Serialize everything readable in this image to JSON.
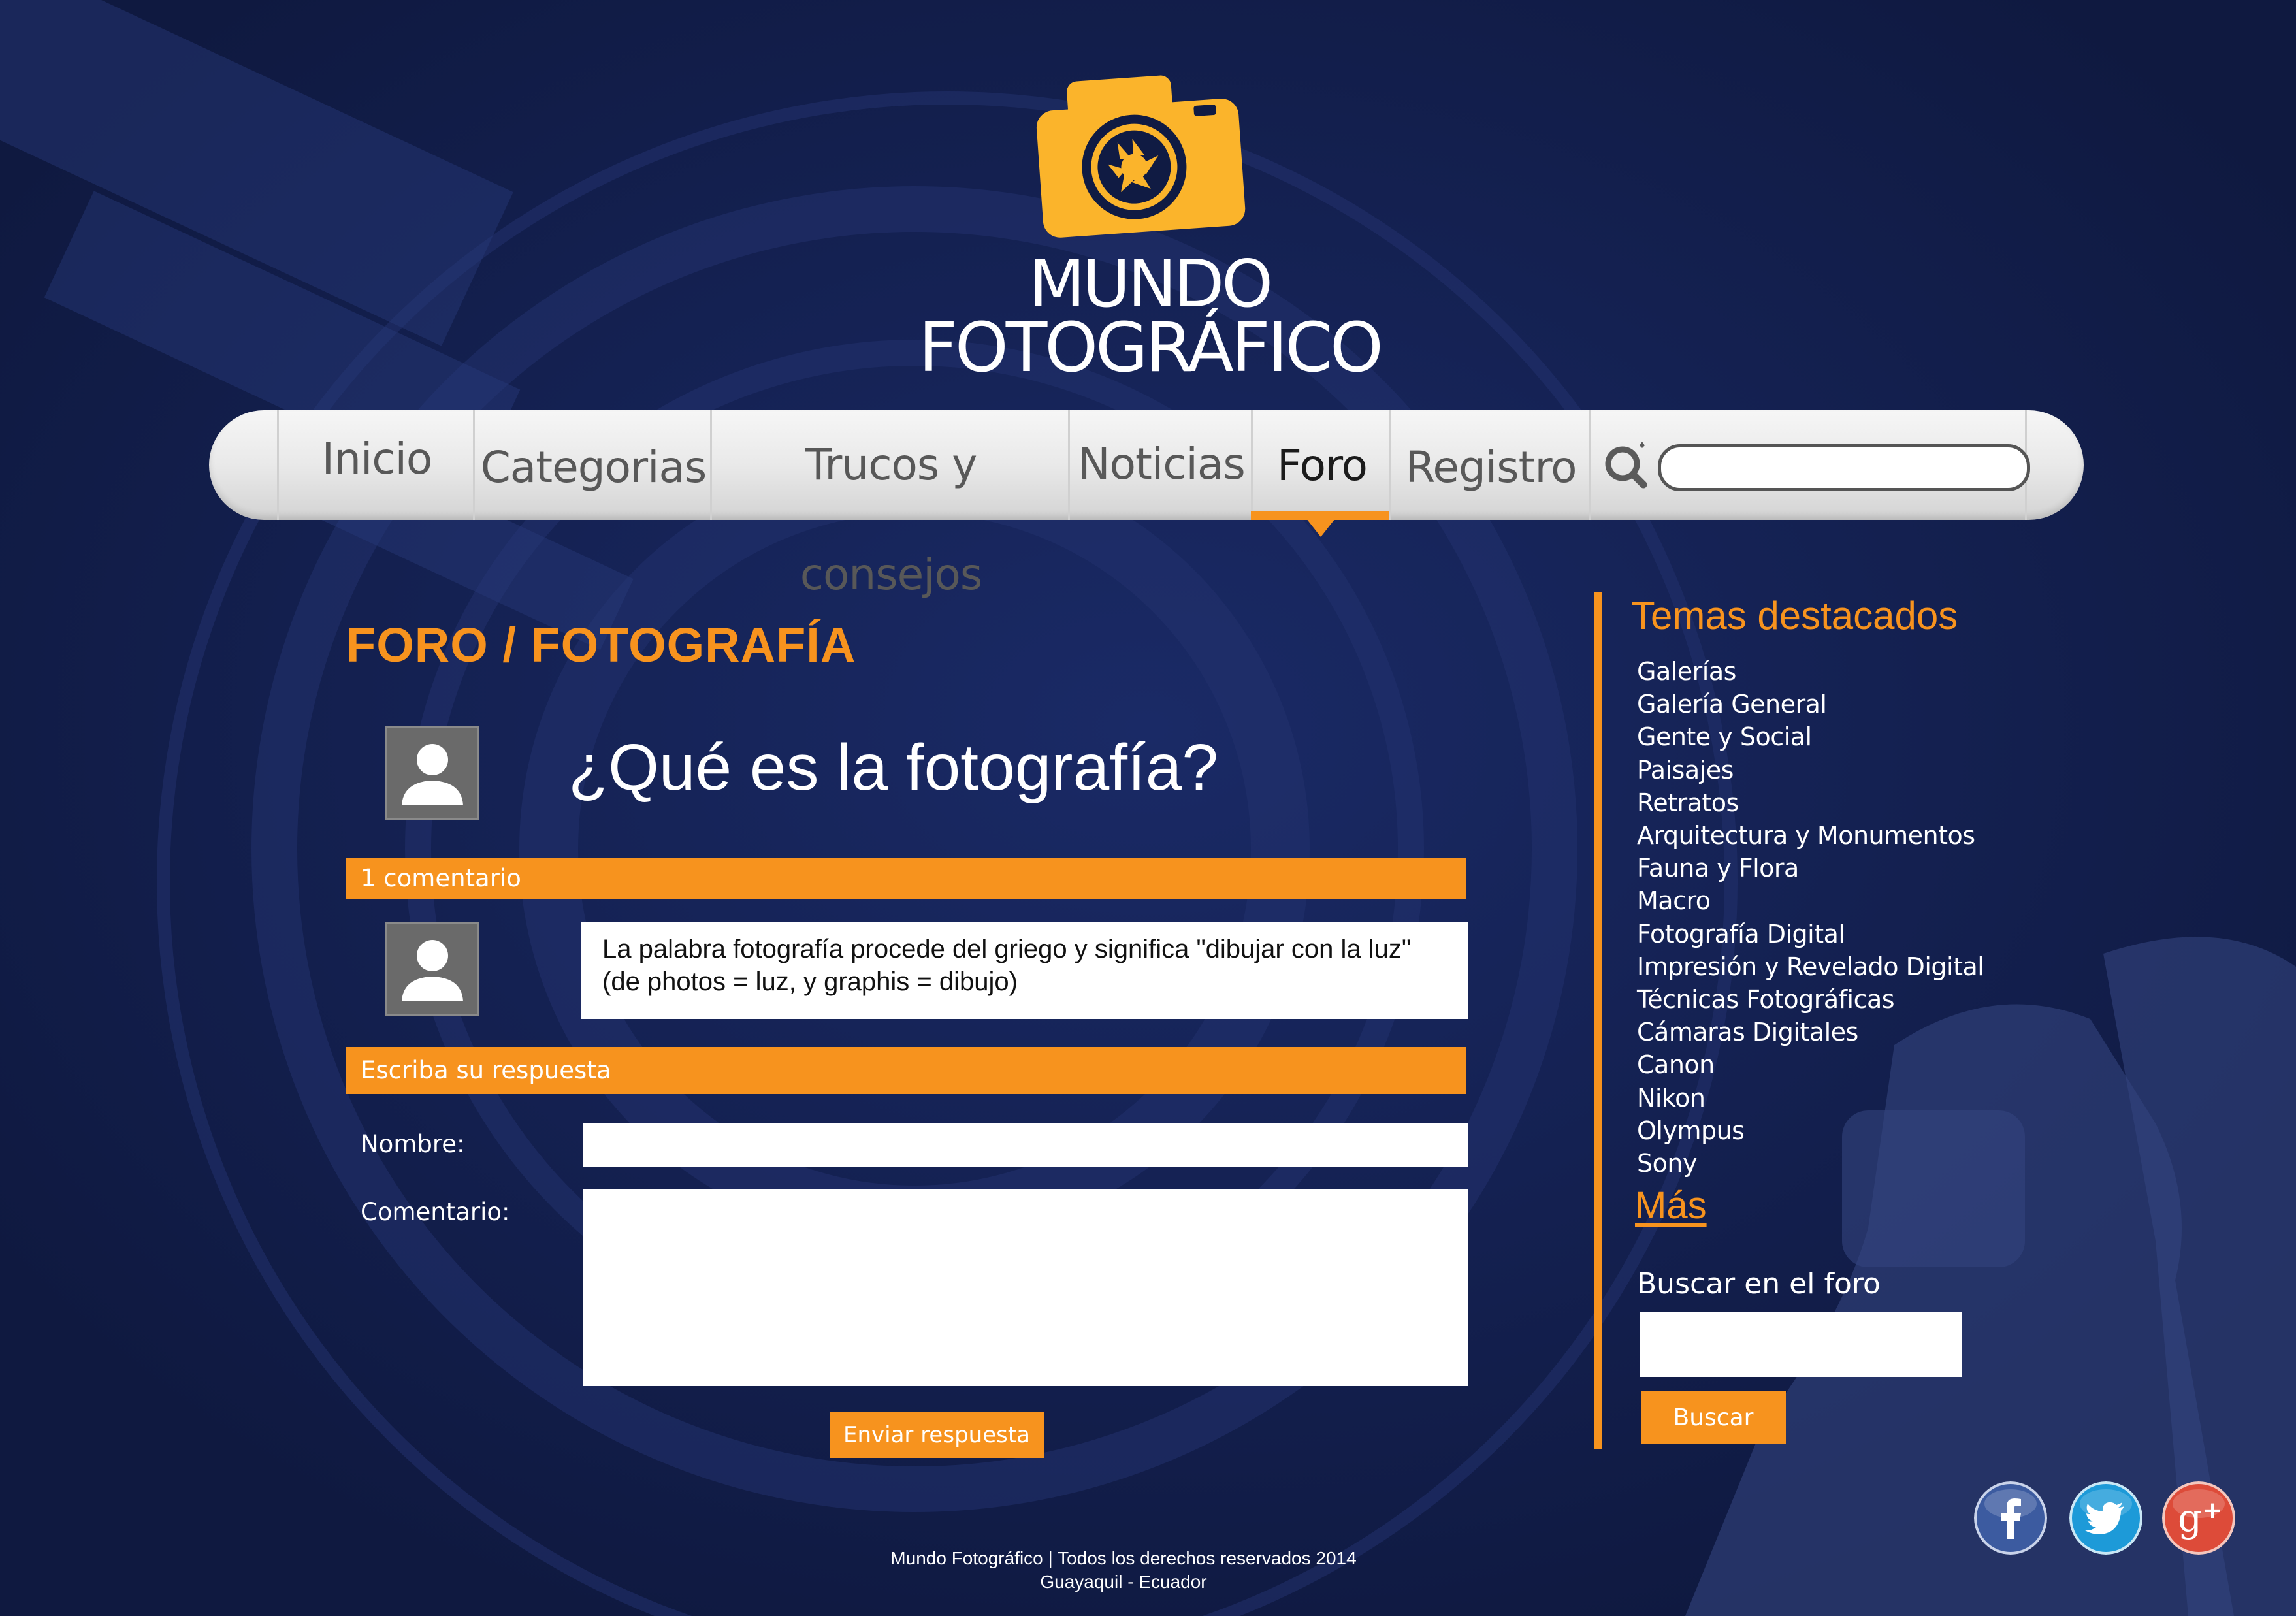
{
  "colors": {
    "background": "#101b43",
    "accent": "#f7931e",
    "logo_camera": "#fbb42b",
    "nav_bar": "#e9e9e9",
    "nav_text": "#585858",
    "nav_active_text": "#1b1b1b",
    "text_light": "#ffffff",
    "facebook": "#3c5ba0",
    "twitter": "#1d9ad8",
    "google_plus": "#dd4b39"
  },
  "logo": {
    "line1": "MUNDO",
    "line2": "FOTOGRÁFICO",
    "icon": "camera-icon"
  },
  "nav": {
    "items": [
      {
        "label": "Inicio"
      },
      {
        "label": "Categorias"
      },
      {
        "label": "Trucos y consejos"
      },
      {
        "label": "Noticias"
      },
      {
        "label": "Foro",
        "active": true
      },
      {
        "label": "Registro"
      }
    ],
    "search_icon": "search-icon",
    "search_value": ""
  },
  "main": {
    "heading": "FORO / FOTOGRAFÍA",
    "topic_title": "¿Qué es la fotografía?",
    "comments_bar": "1 comentario",
    "comment_text_line1": "La palabra fotografía procede del griego y significa \"dibujar con la luz\"",
    "comment_text_line2": "(de photos = luz, y graphis = dibujo)",
    "reply_bar": "Escriba su respuesta",
    "name_label": "Nombre:",
    "comment_label": "Comentario:",
    "name_value": "",
    "comment_value": "",
    "send_button": "Enviar respuesta",
    "avatar_icon": "user-avatar-icon"
  },
  "sidebar": {
    "title": "Temas destacados",
    "topics": [
      "Galerías",
      "Galería General",
      "Gente y Social",
      "Paisajes",
      "Retratos",
      "Arquitectura y Monumentos",
      "Fauna y Flora",
      "Macro",
      "Fotografía Digital",
      "Impresión y Revelado Digital",
      "Técnicas Fotográficas",
      "Cámaras Digitales",
      "Canon",
      "Nikon",
      "Olympus",
      "Sony"
    ],
    "more": "Más",
    "search_label": "Buscar en el foro",
    "search_value": "",
    "search_button": "Buscar"
  },
  "social": {
    "icons": [
      "facebook-icon",
      "twitter-icon",
      "google-plus-icon"
    ]
  },
  "footer": {
    "line1": "Mundo Fotográfico | Todos los derechos reservados 2014",
    "line2": "Guayaquil - Ecuador"
  }
}
